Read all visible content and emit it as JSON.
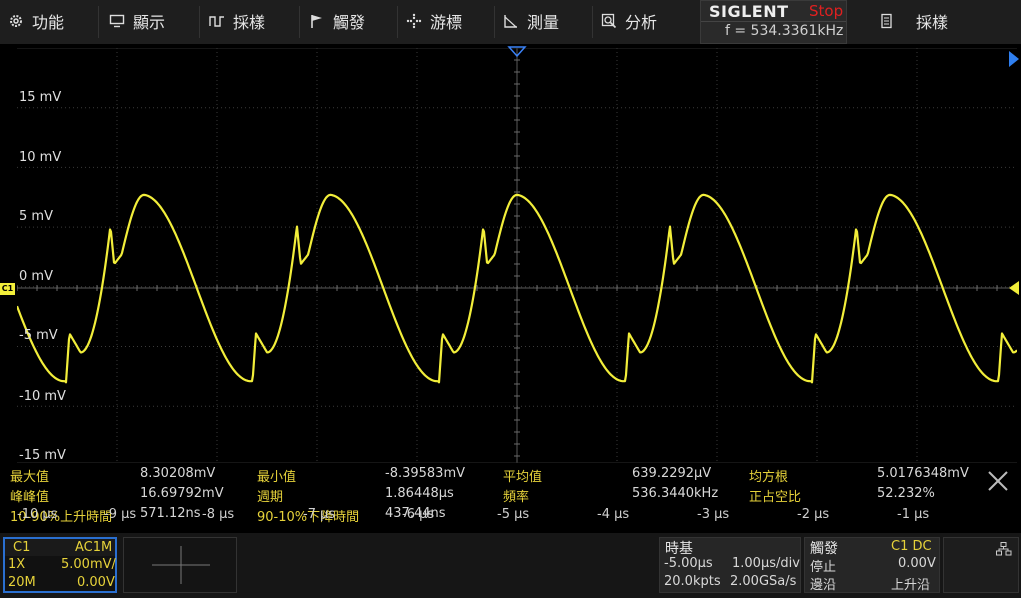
{
  "menu": {
    "function_label": "功能",
    "display_label": "顯示",
    "acquire_label": "採樣",
    "trigger_label": "觸發",
    "cursor_label": "游標",
    "measure_label": "測量",
    "analysis_label": "分析"
  },
  "brand": {
    "logo": "SIGLENT",
    "status": "Stop",
    "frequency": "f = 534.3361kHz"
  },
  "acquire_right": {
    "label": "採樣"
  },
  "voltage_labels": [
    "15 mV",
    "10 mV",
    "5 mV",
    "0 mV",
    "-5 mV",
    "-10 mV",
    "-15 mV"
  ],
  "channel_marker": "C1",
  "measurements": {
    "row1": [
      {
        "label": "最大值",
        "value": "8.30208mV"
      },
      {
        "label": "最小值",
        "value": "-8.39583mV"
      },
      {
        "label": "平均值",
        "value": "639.2292μV"
      },
      {
        "label": "均方根",
        "value": "5.0176348mV"
      }
    ],
    "row2": [
      {
        "label": "峰峰值",
        "value": "16.69792mV"
      },
      {
        "label": "週期",
        "value": "1.86448μs"
      },
      {
        "label": "頻率",
        "value": "536.3440kHz"
      },
      {
        "label": "正占空比",
        "value": "52.232%"
      }
    ],
    "row3": [
      {
        "label": "10-90%上升時間",
        "value": "571.12ns"
      },
      {
        "label": "90-10%下降時間",
        "value": "437.44ns"
      }
    ]
  },
  "time_labels": [
    "-10 μs",
    "-9 μs",
    "-8 μs",
    "-7 μs",
    "-6 μs",
    "-5 μs",
    "-4 μs",
    "-3 μs",
    "-2 μs",
    "-1 μs"
  ],
  "channel_box": {
    "name": "C1",
    "coupling": "AC1M",
    "probe": "1X",
    "scale": "5.00mV/",
    "bandwidth": "20M",
    "offset": "0.00V"
  },
  "timebase": {
    "title": "時基",
    "delay": "-5.00μs",
    "scale": "1.00μs/div",
    "memory": "20.0kpts",
    "sample_rate": "2.00GSa/s"
  },
  "trigger": {
    "title": "觸發",
    "source": "C1 DC",
    "state_label": "停止",
    "level": "0.00V",
    "edge_label": "邊沿",
    "slope": "上升沿"
  },
  "colors": {
    "trace": "#f2ee3a",
    "accent_blue": "#2a6fd0",
    "stop_red": "#e02020"
  }
}
